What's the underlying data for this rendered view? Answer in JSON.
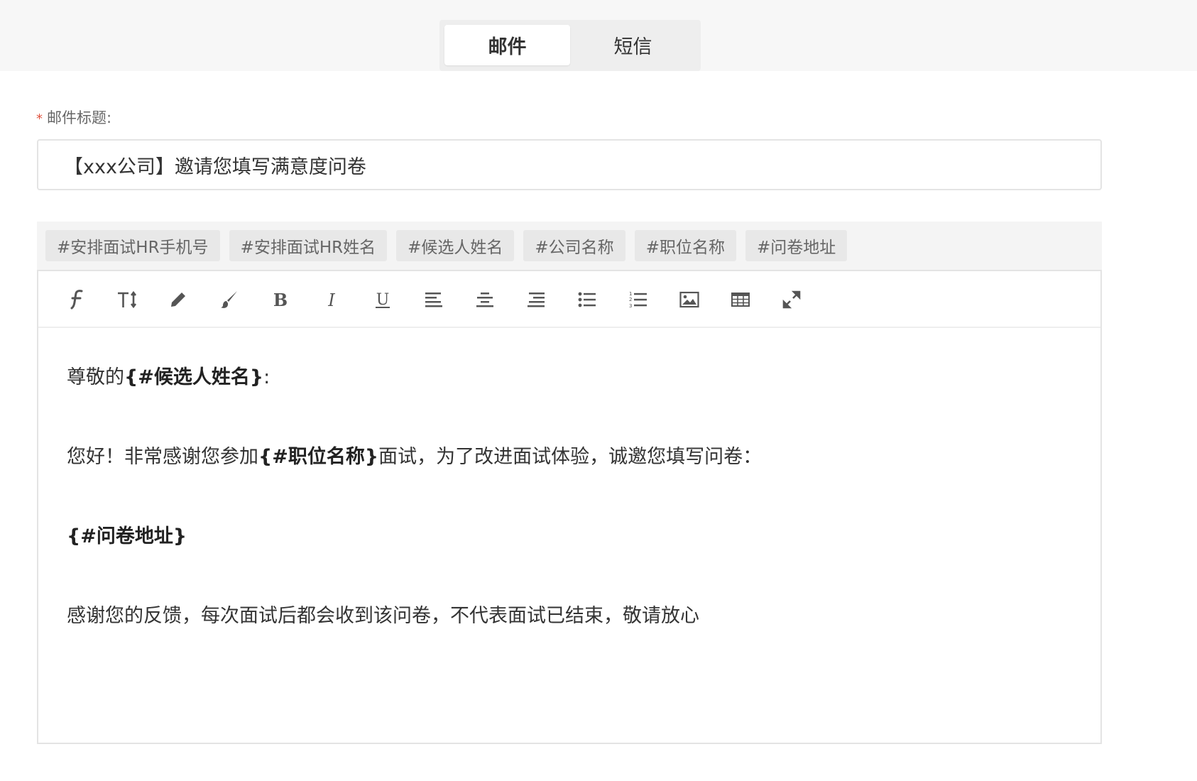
{
  "tabs": [
    {
      "label": "邮件",
      "active": true
    },
    {
      "label": "短信",
      "active": false
    }
  ],
  "subject": {
    "required_mark": "*",
    "label": "邮件标题:",
    "value": "【xxx公司】邀请您填写满意度问卷"
  },
  "variables": [
    "#安排面试HR手机号",
    "#安排面试HR姓名",
    "#候选人姓名",
    "#公司名称",
    "#职位名称",
    "#问卷地址"
  ],
  "toolbar": {
    "icons": [
      "font-family-icon",
      "font-size-icon",
      "pencil-icon",
      "brush-icon",
      "bold-icon",
      "italic-icon",
      "underline-icon",
      "align-left-icon",
      "align-center-icon",
      "align-right-icon",
      "bullet-list-icon",
      "numbered-list-icon",
      "image-icon",
      "table-icon",
      "fullscreen-icon"
    ]
  },
  "body": {
    "greeting_prefix": "尊敬的",
    "greeting_var": "{#候选人姓名}",
    "greeting_suffix": ":",
    "p1_prefix": "您好！非常感谢您参加",
    "p1_var": "{#职位名称}",
    "p1_suffix": "面试，为了改进面试体验，诚邀您填写问卷：",
    "p2_var": "{#问卷地址}",
    "p3": "感谢您的反馈，每次面试后都会收到该问卷，不代表面试已结束，敬请放心"
  }
}
